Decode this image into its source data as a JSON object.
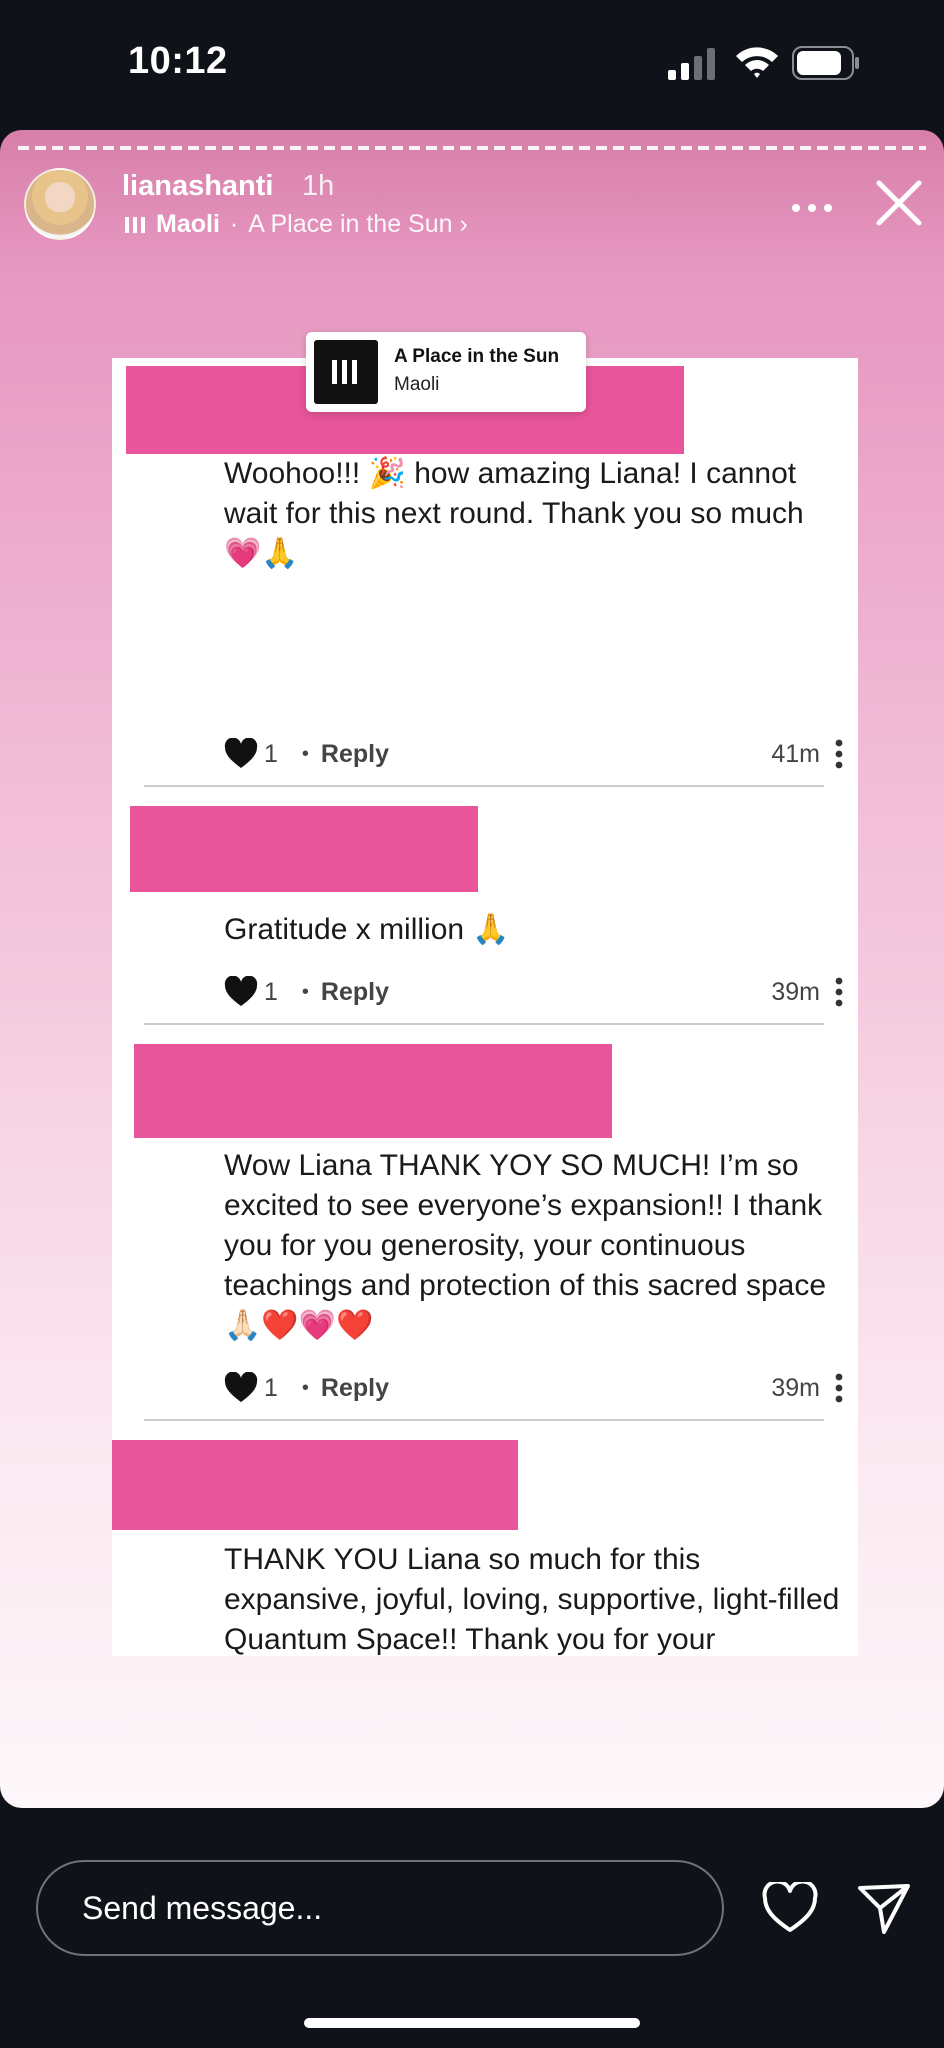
{
  "status_bar": {
    "time": "10:12"
  },
  "story": {
    "username": "lianashanti",
    "time_ago": "1h",
    "music": {
      "artist": "Maoli",
      "separator": "·",
      "song": "A Place in the Sun ›"
    }
  },
  "sticker": {
    "title": "A Place in the Sun",
    "artist": "Maoli"
  },
  "comments": [
    {
      "text": "Woohoo!!! 🎉 how amazing Liana! I cannot wait for this next round. Thank you so much 💗🙏",
      "likes": "1",
      "reply": "Reply",
      "time": "41m"
    },
    {
      "text": "Gratitude x million 🙏",
      "likes": "1",
      "reply": "Reply",
      "time": "39m"
    },
    {
      "text": "Wow Liana THANK YOY SO MUCH! I’m so excited to see everyone’s expansion!! I thank you for you generosity, your continuous teachings and protection of this sacred space🙏🏻❤️💗❤️",
      "likes": "1",
      "reply": "Reply",
      "time": "39m"
    },
    {
      "text": "THANK YOU Liana so much for this expansive, joyful, loving, supportive, light-filled Quantum Space!! Thank you for your unending generosity and your willingness to share the universal teachings with us. This is just the beginning ✨🥰🙏🏻"
    }
  ],
  "bottom_bar": {
    "message_placeholder": "Send message..."
  },
  "colors": {
    "redaction": "#e8559a",
    "story_top": "#d77fa9",
    "story_bottom": "#fdf7fa"
  },
  "icons": [
    "signal-icon",
    "wifi-icon",
    "battery-icon",
    "more-icon",
    "close-icon",
    "heart-icon",
    "kebab-icon",
    "send-icon"
  ]
}
